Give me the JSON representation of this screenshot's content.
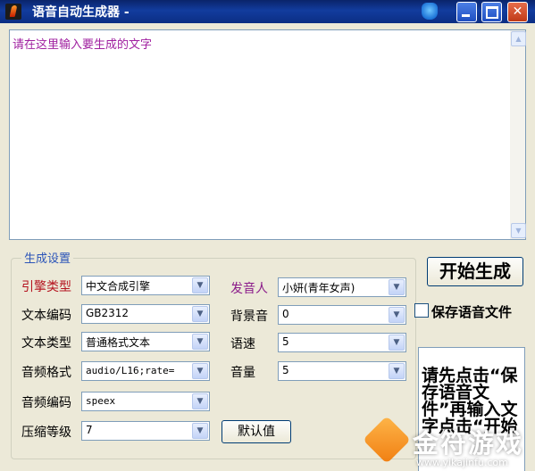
{
  "window": {
    "title": "语音自动生成器 -"
  },
  "editor": {
    "placeholder_text": "请在这里输入要生成的文字"
  },
  "settings": {
    "group_title": "生成设置",
    "engine_type": {
      "label": "引擎类型",
      "value": "中文合成引擎"
    },
    "text_encoding": {
      "label": "文本编码",
      "value": "GB2312"
    },
    "text_type": {
      "label": "文本类型",
      "value": "普通格式文本"
    },
    "audio_format": {
      "label": "音频格式",
      "value": "audio/L16;rate="
    },
    "audio_encoding": {
      "label": "音频编码",
      "value": "speex"
    },
    "compression_level": {
      "label": "压缩等级",
      "value": "7"
    },
    "speaker": {
      "label": "发音人",
      "value": "小妍(青年女声)"
    },
    "background_sound": {
      "label": "背景音",
      "value": "0"
    },
    "speech_rate": {
      "label": "语速",
      "value": "5"
    },
    "volume": {
      "label": "音量",
      "value": "5"
    },
    "default_button": "默认值"
  },
  "actions": {
    "start_button": "开始生成",
    "save_audio_checkbox": {
      "label": "保存语音文件",
      "checked": false
    }
  },
  "note": {
    "text": "请先点击“保存语音文件”再输入文字点击“开始"
  },
  "watermark": {
    "brand": "金符游戏",
    "url": "www.yikajinfu.com"
  },
  "colors": {
    "title_bar": "#0a246a",
    "label_red": "#b5131f",
    "label_purple": "#8a1a8a",
    "placeholder": "#a020a0",
    "group_title": "#2b54b8"
  },
  "icons": {
    "app": "speaker-app-icon",
    "extra": "shield-icon",
    "minimize": "minimize-icon",
    "maximize": "maximize-icon",
    "close": "close-icon",
    "dropdown": "chevron-down-icon"
  }
}
